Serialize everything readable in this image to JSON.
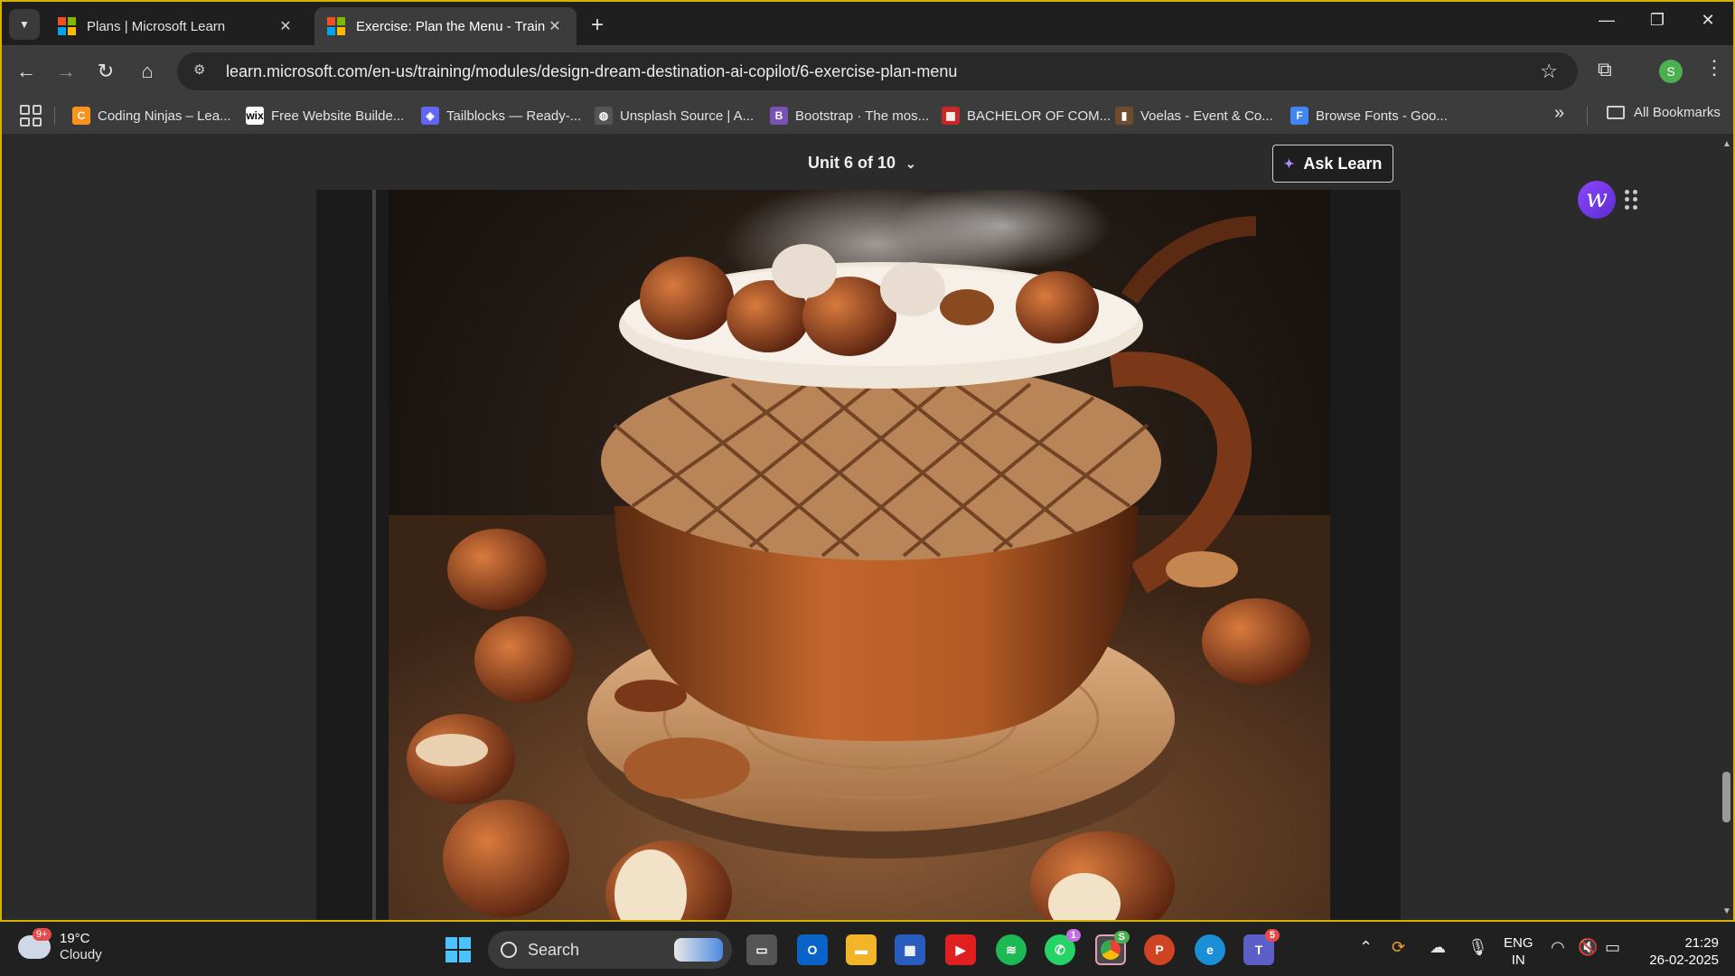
{
  "browser": {
    "tabs": [
      {
        "title": "Plans | Microsoft Learn",
        "active": false
      },
      {
        "title": "Exercise: Plan the Menu - Trainin",
        "active": true
      }
    ],
    "url": "learn.microsoft.com/en-us/training/modules/design-dream-destination-ai-copilot/6-exercise-plan-menu",
    "profile_initial": "S",
    "bookmarks": [
      {
        "label": "Coding Ninjas – Lea...",
        "icon": "coding-ninjas-icon",
        "fav": "C",
        "color": "#f7931e"
      },
      {
        "label": "Free Website Builde...",
        "icon": "wix-icon",
        "fav": "wix",
        "color": "#ffffff"
      },
      {
        "label": "Tailblocks — Ready-...",
        "icon": "tailblocks-icon",
        "fav": "◈",
        "color": "#6366f1"
      },
      {
        "label": "Unsplash Source | A...",
        "icon": "globe-icon",
        "fav": "◍",
        "color": "#555555"
      },
      {
        "label": "Bootstrap · The mos...",
        "icon": "bootstrap-icon",
        "fav": "B",
        "color": "#7952b3"
      },
      {
        "label": "BACHELOR OF COM...",
        "icon": "bcom-icon",
        "fav": "▦",
        "color": "#c62828"
      },
      {
        "label": "Voelas - Event & Co...",
        "icon": "voelas-icon",
        "fav": "▮",
        "color": "#6d4c2f"
      },
      {
        "label": "Browse Fonts - Goo...",
        "icon": "google-fonts-icon",
        "fav": "F",
        "color": "#4285f4"
      }
    ],
    "all_bookmarks": "All Bookmarks"
  },
  "page": {
    "unit_label": "Unit 6 of 10",
    "ask_learn": "Ask Learn",
    "widget_letter": "w",
    "image_alt": "Hazelnut latte in an acorn-shaped cup on a wooden slice, surrounded by hazelnuts"
  },
  "taskbar": {
    "weather": {
      "temp": "19°C",
      "condition": "Cloudy",
      "badge": "9+"
    },
    "search_placeholder": "Search",
    "badges": {
      "whatsapp": "1",
      "chrome": "S",
      "teams": "5"
    },
    "language": {
      "line1": "ENG",
      "line2": "IN"
    },
    "clock": {
      "time": "21:29",
      "date": "26-02-2025"
    }
  },
  "colors": {
    "accent_border": "#d4b400",
    "ask_learn_spark": "#b28cff"
  }
}
